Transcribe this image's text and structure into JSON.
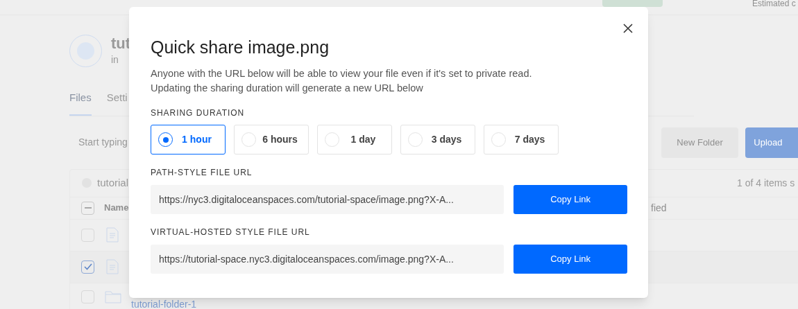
{
  "background": {
    "header": {
      "estimate": "Estimated c"
    },
    "space": {
      "title": "tut",
      "location": "in"
    },
    "tabs": [
      {
        "label": "Files",
        "selected": true
      },
      {
        "label": "Setti",
        "selected": false
      }
    ],
    "search": {
      "placeholder": "Start typing"
    },
    "buttons": [
      "New Folder",
      "Upload"
    ],
    "table": {
      "select_all_indeterminate": true,
      "breadcrumb": "tutorial",
      "selection_count": "1 of 4 items s",
      "columns": [
        "Name",
        "fied"
      ],
      "rows": [
        {
          "kind": "file",
          "checked": false
        },
        {
          "kind": "file",
          "checked": true
        },
        {
          "kind": "folder",
          "checked": false,
          "name": "tutorial-folder-1"
        }
      ]
    }
  },
  "dialog": {
    "title": "Quick share image.png",
    "description": [
      "Anyone with the URL below will be able to view your file even if it's set to private read.",
      "Updating the sharing duration will generate a new URL below"
    ],
    "duration_label": "SHARING DURATION",
    "durations": [
      {
        "label": "1 hour",
        "selected": true
      },
      {
        "label": "6 hours",
        "selected": false
      },
      {
        "label": "1 day",
        "selected": false
      },
      {
        "label": "3 days",
        "selected": false
      },
      {
        "label": "7 days",
        "selected": false
      }
    ],
    "urls": [
      {
        "label": "PATH-STYLE FILE URL",
        "value": "https://nyc3.digitaloceanspaces.com/tutorial-space/image.png?X-A...",
        "button": "Copy Link"
      },
      {
        "label": "VIRTUAL-HOSTED STYLE FILE URL",
        "value": "https://tutorial-space.nyc3.digitaloceanspaces.com/image.png?X-A...",
        "button": "Copy Link"
      }
    ]
  }
}
